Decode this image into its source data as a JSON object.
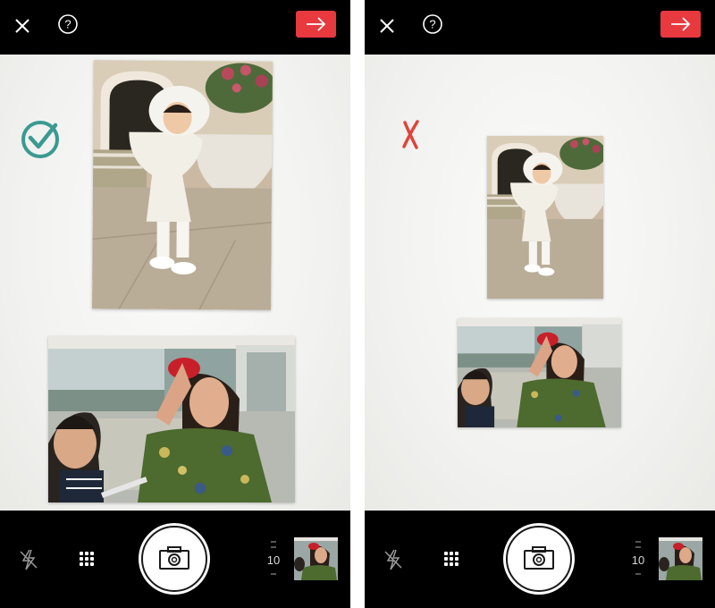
{
  "screens": [
    {
      "id": "left",
      "status": "accepted",
      "status_icon": "check-circle-icon",
      "counter": "10"
    },
    {
      "id": "right",
      "status": "rejected",
      "status_icon": "x-mark-icon",
      "counter": "10"
    }
  ],
  "icons": {
    "close": "close-icon",
    "help": "help-icon",
    "next": "arrow-right-icon",
    "flash": "flash-off-icon",
    "grid": "grid-icon",
    "shutter": "camera-icon"
  },
  "colors": {
    "accent_red": "#e8393f",
    "check_teal": "#3a9a91",
    "reject_red": "#e0443a",
    "bar_black": "#000000"
  }
}
